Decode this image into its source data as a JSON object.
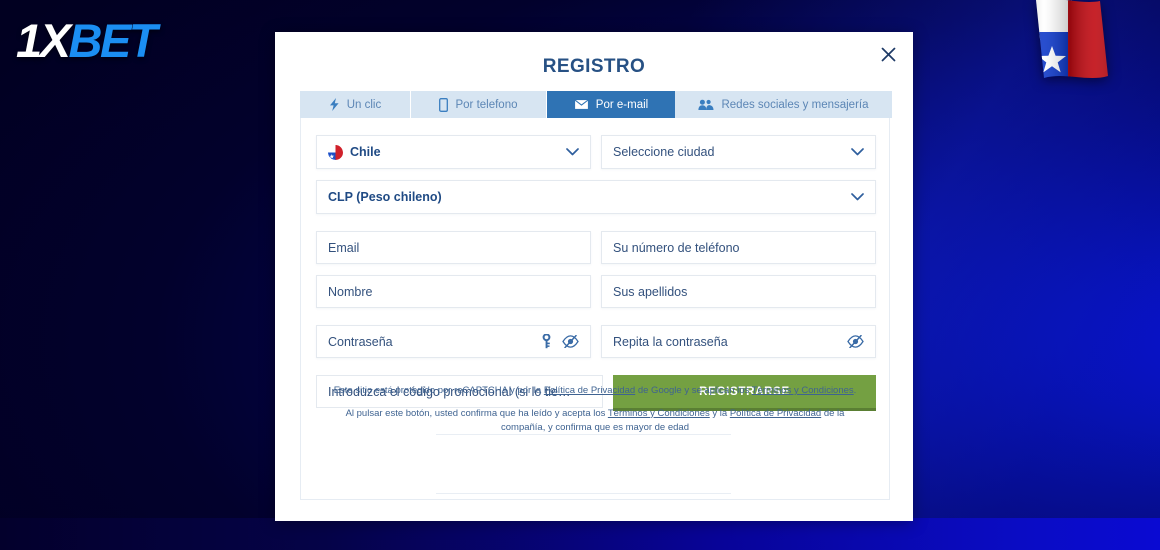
{
  "brand": {
    "logo_part1": "1X",
    "logo_part2": "BET",
    "flag_icon": "chile-flag"
  },
  "modal": {
    "title": "REGISTRO",
    "close_icon": "close-icon"
  },
  "tabs": [
    {
      "label": "Un clic",
      "icon": "lightning-icon",
      "active": false
    },
    {
      "label": "Por telefono",
      "icon": "phone-icon",
      "active": false
    },
    {
      "label": "Por e-mail",
      "icon": "envelope-icon",
      "active": true
    },
    {
      "label": "Redes sociales y mensajería",
      "icon": "people-icon",
      "active": false
    }
  ],
  "form": {
    "country": {
      "value": "Chile",
      "icon": "chile-flag-icon",
      "chevron": "chevron-down-icon"
    },
    "city": {
      "placeholder": "Seleccione ciudad",
      "chevron": "chevron-down-icon"
    },
    "currency": {
      "value": "CLP (Peso chileno)",
      "chevron": "chevron-down-icon"
    },
    "email": {
      "placeholder": "Email"
    },
    "phone": {
      "placeholder": "Su número de teléfono"
    },
    "first_name": {
      "placeholder": "Nombre"
    },
    "last_name": {
      "placeholder": "Sus apellidos"
    },
    "password": {
      "placeholder": "Contraseña",
      "key_icon": "key-icon",
      "eye_icon": "eye-off-icon"
    },
    "password_repeat": {
      "placeholder": "Repita la contraseña",
      "eye_icon": "eye-off-icon"
    },
    "promo": {
      "placeholder": "Introduzca el código promocional (si lo tie…"
    },
    "submit_label": "REGISTRARSE"
  },
  "legal": {
    "line1_a": "Este sitio está protegido por reCAPTCHA y por la ",
    "line1_link1": "Política de Privacidad",
    "line1_b": " de Google y se aplican los ",
    "line1_link2": "Términos y Condiciones",
    "line1_c": ".",
    "line2_a": "Al pulsar este botón, usted confirma que ha leído y acepta los ",
    "line2_link1": "Términos y Condiciones",
    "line2_b": " y la ",
    "line2_link2": "Política de Privacidad",
    "line2_c": " de la compañía, y confirma que es mayor de edad"
  },
  "colors": {
    "accent_blue": "#2f73b4",
    "register_green": "#74a042",
    "title_blue": "#275184",
    "tab_bg": "#d7e5f2"
  }
}
